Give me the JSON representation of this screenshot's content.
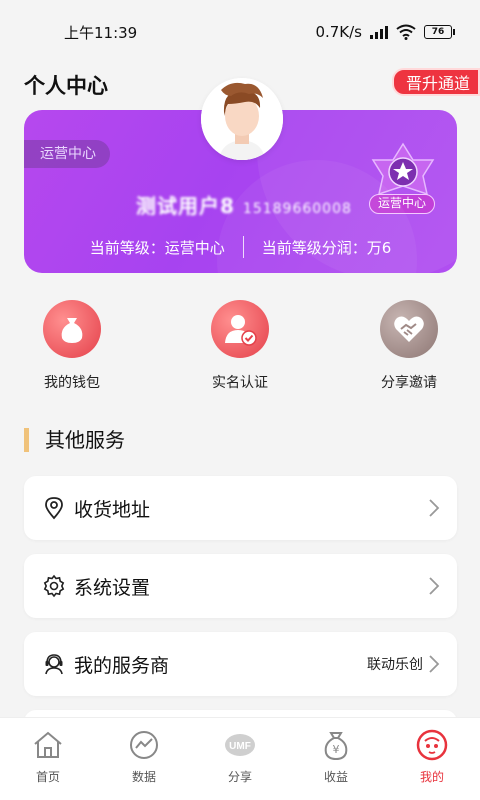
{
  "status_bar": {
    "time": "上午11:39",
    "network_speed": "0.7K/s",
    "signal_tag": "HD",
    "battery": "76"
  },
  "header": {
    "title": "个人中心",
    "promo_label": "晋升通道"
  },
  "profile": {
    "role_tag": "运营中心",
    "name": "测试用户8",
    "phone": "15189660008",
    "level_label": "当前等级：运营中心",
    "share_label": "当前等级分润：万6",
    "badge_label": "运营中心"
  },
  "quick_actions": [
    {
      "label": "我的钱包",
      "icon": "money-bag-icon"
    },
    {
      "label": "实名认证",
      "icon": "id-verify-icon"
    },
    {
      "label": "分享邀请",
      "icon": "handshake-icon"
    }
  ],
  "section": {
    "title": "其他服务"
  },
  "menu": [
    {
      "label": "收货地址",
      "icon": "location-pin-icon",
      "value": ""
    },
    {
      "label": "系统设置",
      "icon": "gear-icon",
      "value": ""
    },
    {
      "label": "我的服务商",
      "icon": "service-agent-icon",
      "value": "联动乐创"
    }
  ],
  "tabbar": [
    {
      "label": "首页",
      "icon": "home-icon",
      "active": false
    },
    {
      "label": "数据",
      "icon": "chart-icon",
      "active": false
    },
    {
      "label": "分享",
      "icon": "umf-share-icon",
      "active": false,
      "icon_text": "UMF"
    },
    {
      "label": "收益",
      "icon": "money-bag-icon",
      "active": false,
      "icon_text": "¥"
    },
    {
      "label": "我的",
      "icon": "profile-face-icon",
      "active": true
    }
  ],
  "colors": {
    "card_gradient_start": "#b648ee",
    "card_gradient_end": "#b14ff1",
    "accent_red": "#e8333d",
    "section_bar": "#f0c27a"
  }
}
